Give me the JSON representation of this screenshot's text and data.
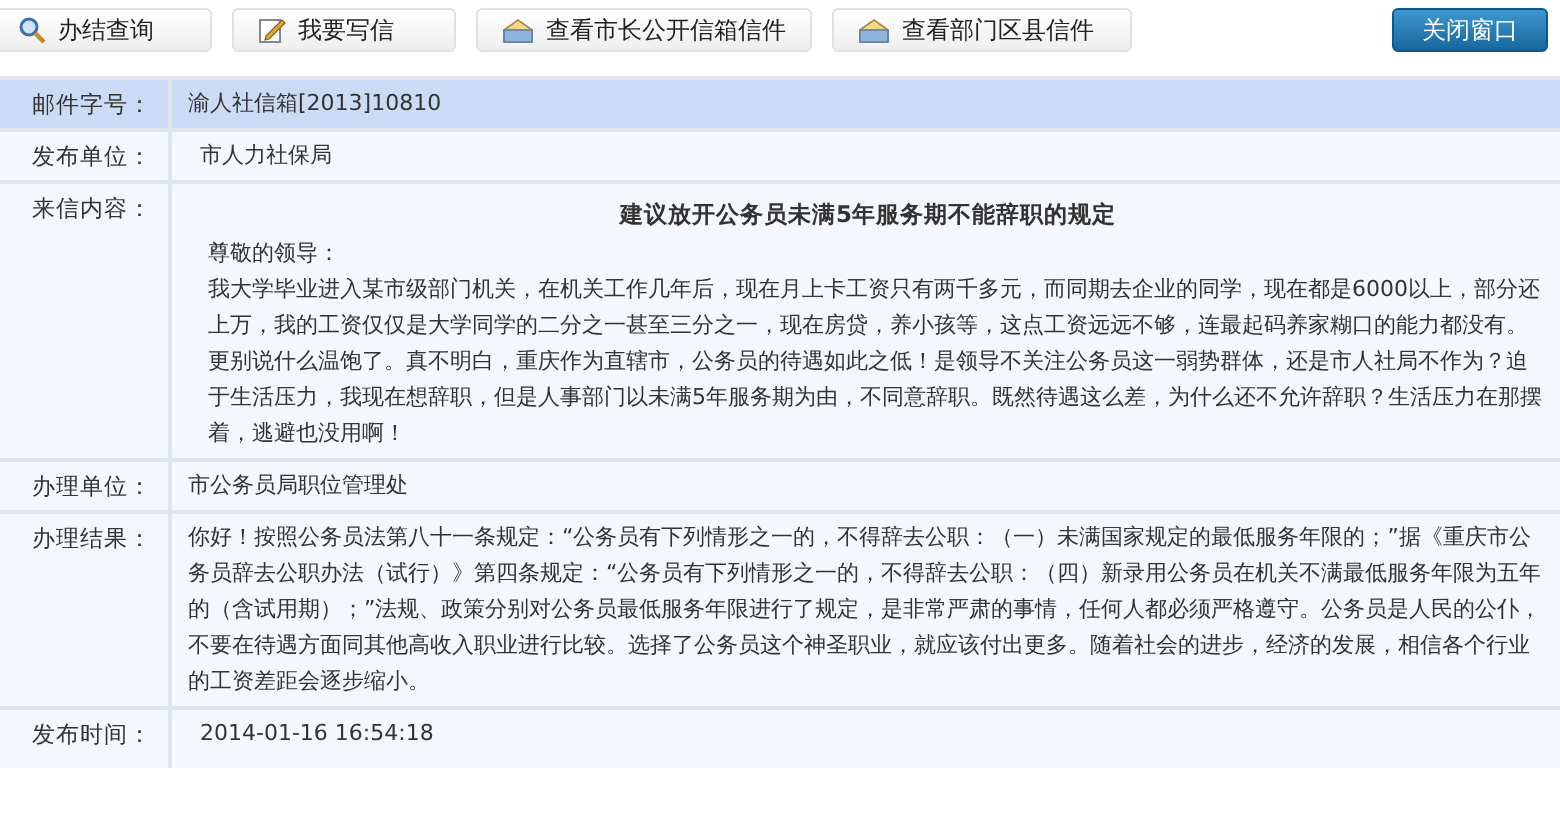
{
  "toolbar": {
    "buttons": [
      {
        "label": "办结查询",
        "kind": "search"
      },
      {
        "label": "我要写信",
        "kind": "write"
      },
      {
        "label": "查看市长公开信箱信件",
        "kind": "mailbox"
      },
      {
        "label": "查看部门区县信件",
        "kind": "mailbox"
      }
    ],
    "close_button": "关闭窗口"
  },
  "rows": [
    {
      "kind": "field",
      "label": "邮件字号：",
      "value": "渝人社信箱[2013]10810",
      "highlighted": true
    },
    {
      "kind": "field",
      "label": "发布单位：",
      "value": "市人力社保局",
      "highlighted": false
    },
    {
      "kind": "letter",
      "label": "来信内容：",
      "title": "建议放开公务员未满5年服务期不能辞职的规定",
      "greeting": "尊敬的领导：",
      "body": "我大学毕业进入某市级部门机关，在机关工作几年后，现在月上卡工资只有两千多元，而同期去企业的同学，现在都是6000以上，部分还上万，我的工资仅仅是大学同学的二分之一甚至三分之一，现在房贷，养小孩等，这点工资远远不够，连最起码养家糊口的能力都没有。更别说什么温饱了。真不明白，重庆作为直辖市，公务员的待遇如此之低！是领导不关注公务员这一弱势群体，还是市人社局不作为？迫于生活压力，我现在想辞职，但是人事部门以未满5年服务期为由，不同意辞职。既然待遇这么差，为什么还不允许辞职？生活压力在那摆着，逃避也没用啊！",
      "highlighted": false
    },
    {
      "kind": "field",
      "label": "办理单位：",
      "value": "市公务员局职位管理处",
      "highlighted": false
    },
    {
      "kind": "field",
      "label": "办理结果：",
      "value": "你好！按照公务员法第八十一条规定：“公务员有下列情形之一的，不得辞去公职：（一）未满国家规定的最低服务年限的；”据《重庆市公务员辞去公职办法（试行）》第四条规定：“公务员有下列情形之一的，不得辞去公职：（四）新录用公务员在机关不满最低服务年限为五年的（含试用期）；”法规、政策分别对公务员最低服务年限进行了规定，是非常严肃的事情，任何人都必须严格遵守。公务员是人民的公仆，不要在待遇方面同其他高收入职业进行比较。选择了公务员这个神圣职业，就应该付出更多。随着社会的进步，经济的发展，相信各个行业的工资差距会逐步缩小。",
      "highlighted": false
    },
    {
      "kind": "field",
      "label": "发布时间：",
      "value": "2014-01-16 16:54:18",
      "highlighted": false
    }
  ]
}
